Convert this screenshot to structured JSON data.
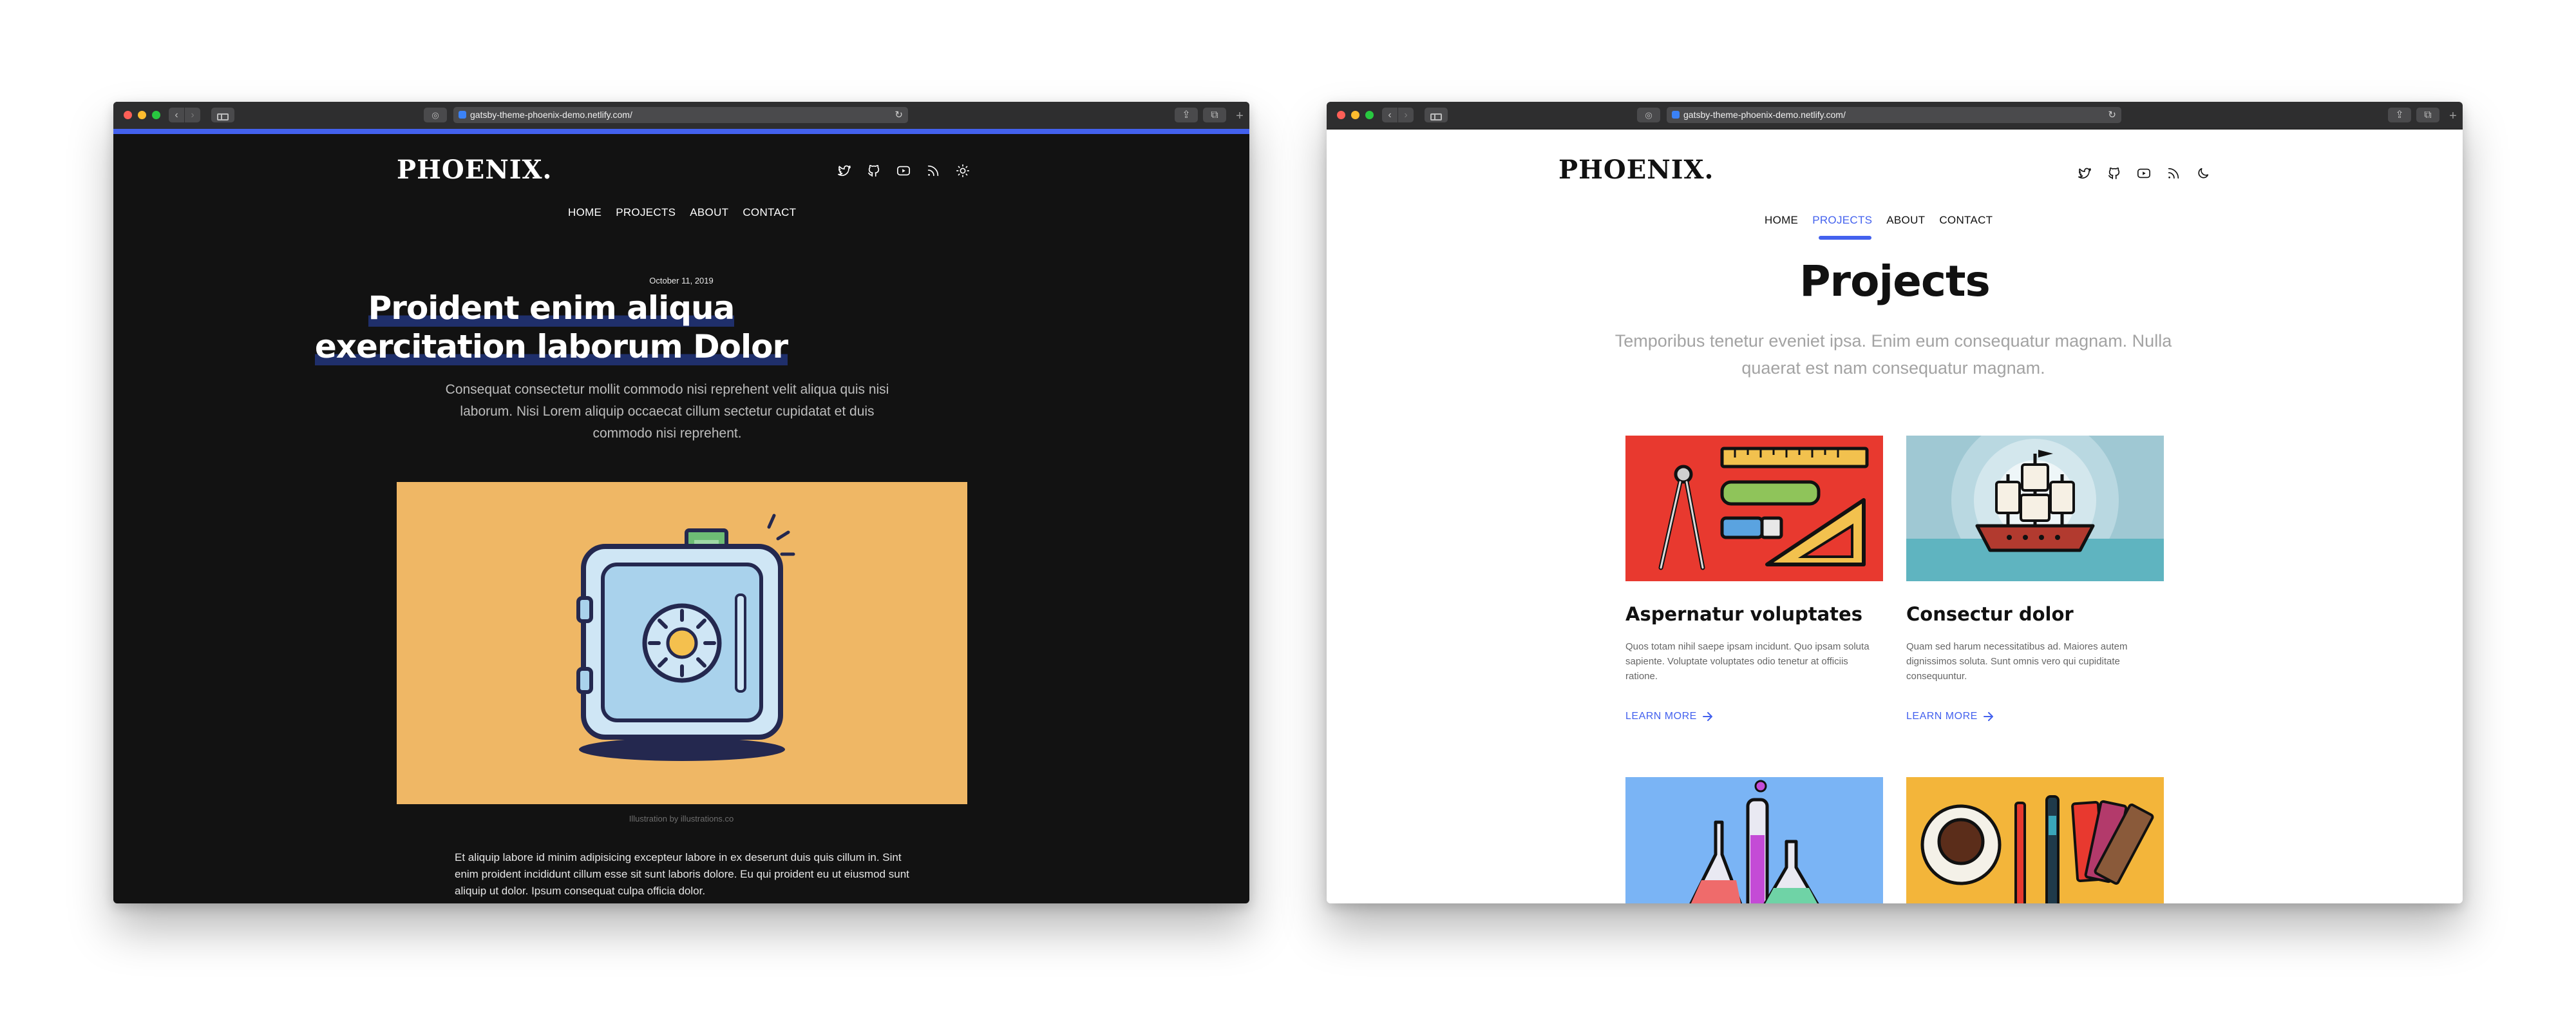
{
  "browser_left": {
    "url": "gatsby-theme-phoenix-demo.netlify.com/"
  },
  "browser_right": {
    "url": "gatsby-theme-phoenix-demo.netlify.com/"
  },
  "site": {
    "logo": "PHOENIX.",
    "menu": [
      "HOME",
      "PROJECTS",
      "ABOUT",
      "CONTACT"
    ],
    "social_icons": [
      "twitter-icon",
      "github-icon",
      "youtube-icon",
      "rss-icon"
    ],
    "accent_color": "#4361ee"
  },
  "post": {
    "date": "October 11, 2019",
    "title_line1": "Proident enim aliqua",
    "title_line2": "exercitation laborum Dolor",
    "description": "Consequat consectetur mollit commodo nisi reprehent velit aliqua quis nisi laborum. Nisi Lorem aliquip occaecat cillum sectetur cupidatat et duis commodo nisi reprehent.",
    "image_caption": "Illustration by illustrations.co",
    "body": "Et aliquip labore id minim adipisicing excepteur labore in ex deserunt duis quis cillum in. Sint enim proident incididunt cillum esse sit sunt laboris dolore. Eu qui proident eu ut eiusmod sunt aliquip ut dolor. Ipsum consequat culpa officia dolor."
  },
  "projects": {
    "title": "Projects",
    "subtitle": "Temporibus tenetur eveniet ipsa. Enim eum consequatur magnam. Nulla quaerat est nam consequatur magnam.",
    "cards": [
      {
        "title": "Aspernatur voluptates",
        "description": "Quos totam nihil saepe ipsam incidunt. Quo ipsam soluta sapiente. Voluptate voluptates odio tenetur at officiis ratione.",
        "link": "LEARN MORE",
        "image_bg": "#e8392f"
      },
      {
        "title": "Consectur dolor",
        "description": "Quam sed harum necessitatibus ad. Maiores autem dignissimos soluta. Sunt omnis vero qui cupiditate consequuntur.",
        "link": "LEARN MORE",
        "image_bg": "#9fc8d3"
      }
    ],
    "more_images_bg": [
      "#7ab4f5",
      "#f3b53a"
    ]
  }
}
